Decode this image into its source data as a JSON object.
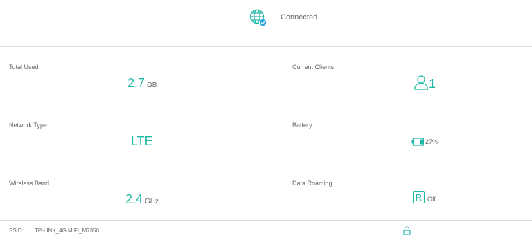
{
  "status": {
    "connection_text": "Connected",
    "icon": "globe-icon",
    "check_badge": "check-badge-icon"
  },
  "cells": {
    "total_used": {
      "label": "Total Used",
      "value": "2.7",
      "unit": "GB"
    },
    "current_clients": {
      "label": "Current Clients",
      "value": "1",
      "icon": "user-icon"
    },
    "network_type": {
      "label": "Network Type",
      "value": "LTE"
    },
    "battery": {
      "label": "Battery",
      "value": "27%",
      "icon": "battery-icon",
      "level": 0.27
    },
    "wireless_band": {
      "label": "Wireless Band",
      "value": "2.4",
      "unit": "GHz"
    },
    "data_roaming": {
      "label": "Data Roaming",
      "value": "Off",
      "icon": "roaming-icon",
      "icon_letter": "R"
    }
  },
  "ssid": {
    "label": "SSID:",
    "value": "TP-LINK_4G MIFI_M7350",
    "icon": "lock-icon"
  },
  "colors": {
    "accent": "#1fb7a6",
    "badge": "#2aa8e0",
    "divider": "#dddddd",
    "text": "#666666"
  }
}
